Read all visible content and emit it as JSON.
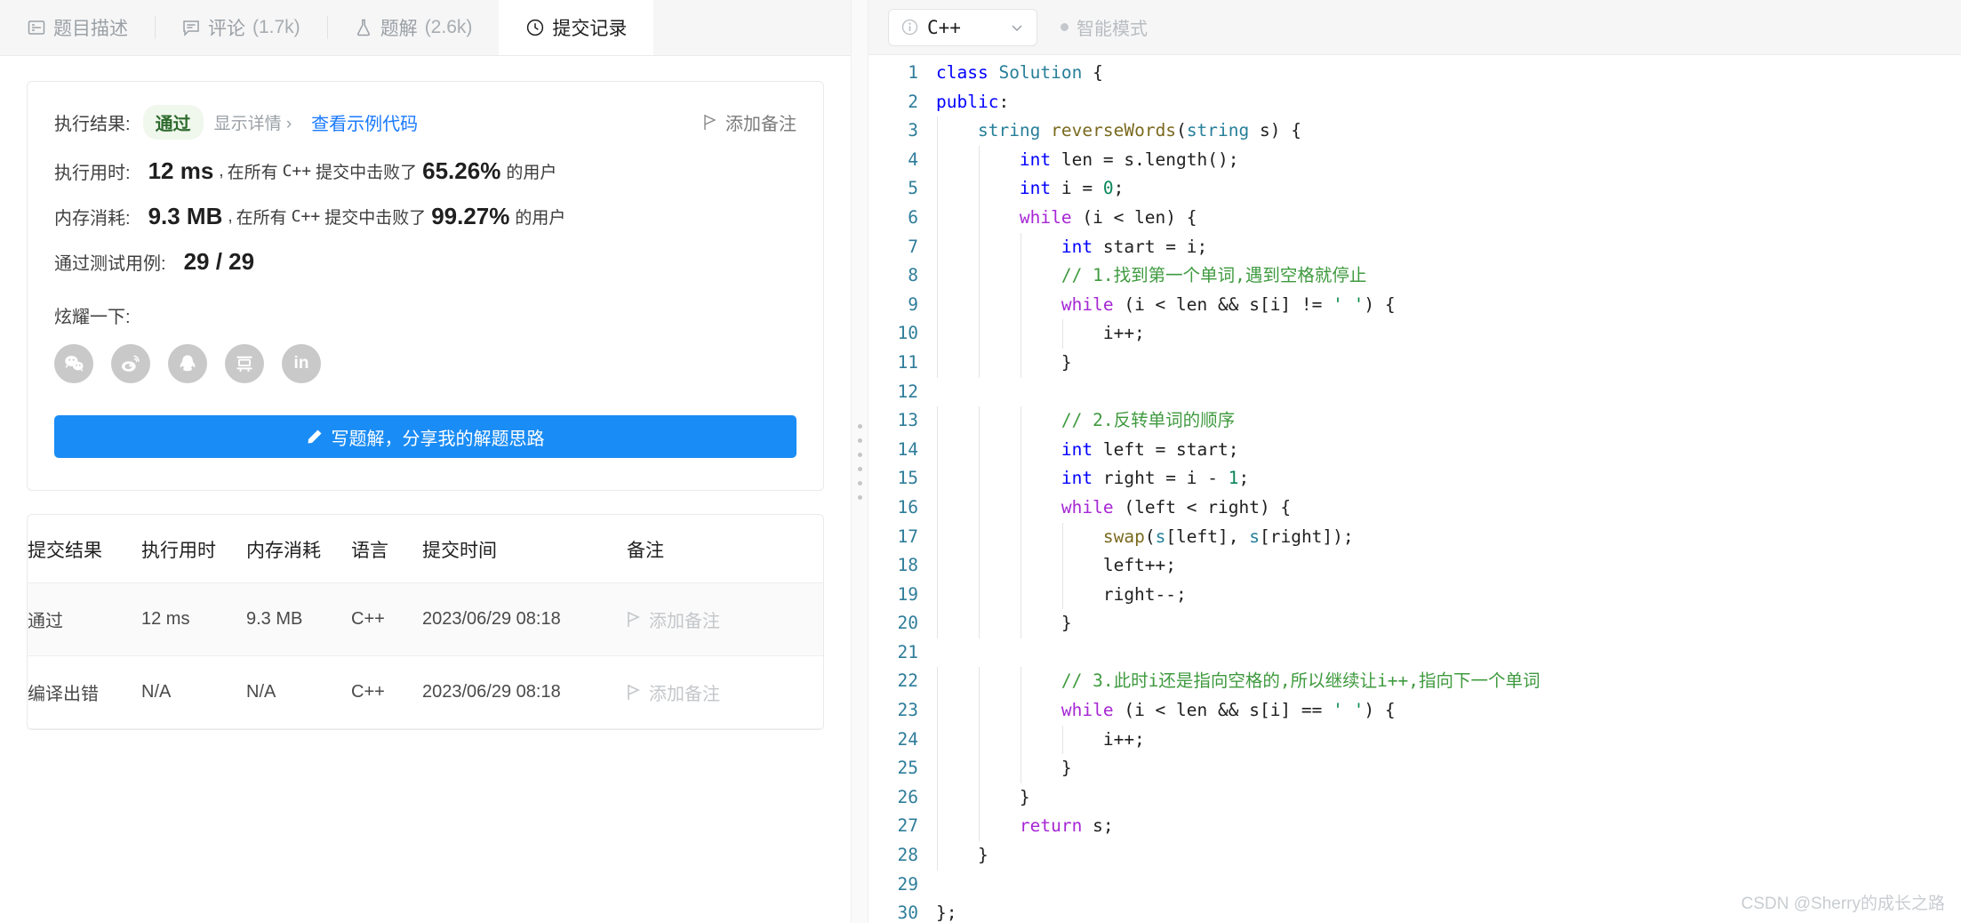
{
  "tabs": [
    {
      "label": "题目描述",
      "count": "",
      "icon": "document-icon",
      "active": false
    },
    {
      "label": "评论",
      "count": "(1.7k)",
      "icon": "comment-icon",
      "active": false
    },
    {
      "label": "题解",
      "count": "(2.6k)",
      "icon": "flask-icon",
      "active": false
    },
    {
      "label": "提交记录",
      "count": "",
      "icon": "clock-icon",
      "active": true
    }
  ],
  "result": {
    "result_label": "执行结果:",
    "status": "通过",
    "show_detail": "显示详情 ›",
    "view_sample_code": "查看示例代码",
    "add_note": "添加备注",
    "runtime_label": "执行用时:",
    "runtime_value": "12 ms",
    "runtime_sep": ",",
    "runtime_desc_pre": "在所有",
    "runtime_lang": "C++",
    "runtime_desc_mid": "提交中击败了",
    "runtime_percent": "65.26%",
    "runtime_desc_post": "的用户",
    "memory_label": "内存消耗:",
    "memory_value": "9.3 MB",
    "memory_percent": "99.27%",
    "testcase_label": "通过测试用例:",
    "testcase_value": "29 / 29",
    "show_off_label": "炫耀一下:",
    "share_buttons": [
      {
        "name": "wechat-share-icon",
        "label": "微信"
      },
      {
        "name": "weibo-share-icon",
        "label": "微博"
      },
      {
        "name": "qq-share-icon",
        "label": "QQ"
      },
      {
        "name": "douban-share-icon",
        "label": "豆瓣"
      },
      {
        "name": "linkedin-share-icon",
        "label": "in"
      }
    ],
    "write_button": "写题解，分享我的解题思路"
  },
  "submissions": {
    "headers": [
      "提交结果",
      "执行用时",
      "内存消耗",
      "语言",
      "提交时间",
      "备注"
    ],
    "rows": [
      {
        "status": "通过",
        "status_type": "pass",
        "runtime": "12 ms",
        "memory": "9.3 MB",
        "language": "C++",
        "time": "2023/06/29 08:18",
        "note": "添加备注"
      },
      {
        "status": "编译出错",
        "status_type": "fail",
        "runtime": "N/A",
        "memory": "N/A",
        "language": "C++",
        "time": "2023/06/29 08:18",
        "note": "添加备注"
      }
    ]
  },
  "editor": {
    "language": "C++",
    "smart_mode": "智能模式",
    "watermark": "CSDN @Sherry的成长之路",
    "total_lines": 30
  },
  "colors": {
    "accent_blue": "#1a8cf5",
    "link_blue": "#1a7aff",
    "pass_green": "#4caf50",
    "fail_red": "#ef4743",
    "badge_bg": "#f0f7ec",
    "badge_text": "#2e6b2e",
    "line_number": "#2e7d9a",
    "comment_green": "#3f9a3f",
    "keyword_blue": "#0000ff",
    "keyword_purple": "#a626d4",
    "type_teal": "#267f99"
  },
  "code": [
    {
      "n": 1,
      "indent": 0,
      "tokens": [
        [
          "k",
          "class"
        ],
        [
          "op",
          " "
        ],
        [
          "ty",
          "Solution"
        ],
        [
          "op",
          " {"
        ]
      ]
    },
    {
      "n": 2,
      "indent": 0,
      "tokens": [
        [
          "k",
          "public"
        ],
        [
          "op",
          ":"
        ]
      ]
    },
    {
      "n": 3,
      "indent": 1,
      "tokens": [
        [
          "op",
          "    "
        ],
        [
          "ty",
          "string"
        ],
        [
          "op",
          " "
        ],
        [
          "fn",
          "reverseWords"
        ],
        [
          "op",
          "("
        ],
        [
          "ty",
          "string"
        ],
        [
          "op",
          " s) {"
        ]
      ]
    },
    {
      "n": 4,
      "indent": 2,
      "tokens": [
        [
          "op",
          "        "
        ],
        [
          "k",
          "int"
        ],
        [
          "op",
          " len = s.length();"
        ]
      ]
    },
    {
      "n": 5,
      "indent": 2,
      "tokens": [
        [
          "op",
          "        "
        ],
        [
          "k",
          "int"
        ],
        [
          "op",
          " i = "
        ],
        [
          "num",
          "0"
        ],
        [
          "op",
          ";"
        ]
      ]
    },
    {
      "n": 6,
      "indent": 2,
      "tokens": [
        [
          "op",
          "        "
        ],
        [
          "kw",
          "while"
        ],
        [
          "op",
          " (i < len) {"
        ]
      ]
    },
    {
      "n": 7,
      "indent": 3,
      "tokens": [
        [
          "op",
          "            "
        ],
        [
          "k",
          "int"
        ],
        [
          "op",
          " start = i;"
        ]
      ]
    },
    {
      "n": 8,
      "indent": 3,
      "tokens": [
        [
          "op",
          "            "
        ],
        [
          "cm",
          "// 1.找到第一个单词,遇到空格就停止"
        ]
      ]
    },
    {
      "n": 9,
      "indent": 3,
      "tokens": [
        [
          "op",
          "            "
        ],
        [
          "kw",
          "while"
        ],
        [
          "op",
          " (i < len && s[i] != "
        ],
        [
          "str",
          "' '"
        ],
        [
          "op",
          ") {"
        ]
      ]
    },
    {
      "n": 10,
      "indent": 4,
      "tokens": [
        [
          "op",
          "                i++;"
        ]
      ]
    },
    {
      "n": 11,
      "indent": 3,
      "tokens": [
        [
          "op",
          "            }"
        ]
      ]
    },
    {
      "n": 12,
      "indent": 0,
      "tokens": [
        [
          "op",
          ""
        ]
      ]
    },
    {
      "n": 13,
      "indent": 3,
      "tokens": [
        [
          "op",
          "            "
        ],
        [
          "cm",
          "// 2.反转单词的顺序"
        ]
      ]
    },
    {
      "n": 14,
      "indent": 3,
      "tokens": [
        [
          "op",
          "            "
        ],
        [
          "k",
          "int"
        ],
        [
          "op",
          " left = start;"
        ]
      ]
    },
    {
      "n": 15,
      "indent": 3,
      "tokens": [
        [
          "op",
          "            "
        ],
        [
          "k",
          "int"
        ],
        [
          "op",
          " right = i - "
        ],
        [
          "num",
          "1"
        ],
        [
          "op",
          ";"
        ]
      ]
    },
    {
      "n": 16,
      "indent": 3,
      "tokens": [
        [
          "op",
          "            "
        ],
        [
          "kw",
          "while"
        ],
        [
          "op",
          " (left < right) {"
        ]
      ]
    },
    {
      "n": 17,
      "indent": 4,
      "tokens": [
        [
          "op",
          "                "
        ],
        [
          "fn",
          "swap"
        ],
        [
          "op",
          "("
        ],
        [
          "vr",
          "s"
        ],
        [
          "op",
          "[left], "
        ],
        [
          "vr",
          "s"
        ],
        [
          "op",
          "[right]);"
        ]
      ]
    },
    {
      "n": 18,
      "indent": 4,
      "tokens": [
        [
          "op",
          "                left++;"
        ]
      ]
    },
    {
      "n": 19,
      "indent": 4,
      "tokens": [
        [
          "op",
          "                right--;"
        ]
      ]
    },
    {
      "n": 20,
      "indent": 3,
      "tokens": [
        [
          "op",
          "            }"
        ]
      ]
    },
    {
      "n": 21,
      "indent": 0,
      "tokens": [
        [
          "op",
          ""
        ]
      ]
    },
    {
      "n": 22,
      "indent": 3,
      "tokens": [
        [
          "op",
          "            "
        ],
        [
          "cm",
          "// 3.此时i还是指向空格的,所以继续让i++,指向下一个单词"
        ]
      ]
    },
    {
      "n": 23,
      "indent": 3,
      "tokens": [
        [
          "op",
          "            "
        ],
        [
          "kw",
          "while"
        ],
        [
          "op",
          " (i < len && s[i] == "
        ],
        [
          "str",
          "' '"
        ],
        [
          "op",
          ") {"
        ]
      ]
    },
    {
      "n": 24,
      "indent": 4,
      "tokens": [
        [
          "op",
          "                i++;"
        ]
      ]
    },
    {
      "n": 25,
      "indent": 3,
      "tokens": [
        [
          "op",
          "            }"
        ]
      ]
    },
    {
      "n": 26,
      "indent": 2,
      "tokens": [
        [
          "op",
          "        }"
        ]
      ]
    },
    {
      "n": 27,
      "indent": 2,
      "tokens": [
        [
          "op",
          "        "
        ],
        [
          "kw",
          "return"
        ],
        [
          "op",
          " s;"
        ]
      ]
    },
    {
      "n": 28,
      "indent": 1,
      "tokens": [
        [
          "op",
          "    }"
        ]
      ]
    },
    {
      "n": 29,
      "indent": 0,
      "tokens": [
        [
          "op",
          ""
        ]
      ]
    },
    {
      "n": 30,
      "indent": 0,
      "tokens": [
        [
          "op",
          "};"
        ]
      ]
    }
  ]
}
